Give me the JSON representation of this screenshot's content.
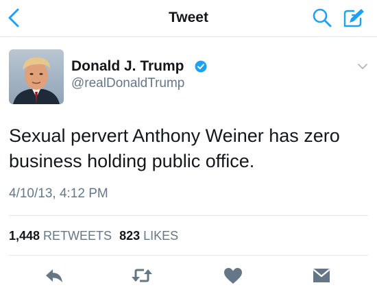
{
  "header": {
    "title": "Tweet",
    "back_icon": "chevron-left-icon",
    "search_icon": "search-icon",
    "compose_icon": "compose-icon"
  },
  "author": {
    "name": "Donald J. Trump",
    "handle": "@realDonaldTrump",
    "verified": true,
    "avatar_icon": "avatar-photo"
  },
  "tweet": {
    "text": "Sexual pervert Anthony Weiner has zero business holding public office.",
    "timestamp": "4/10/13, 4:12 PM"
  },
  "stats": {
    "retweets_count": "1,448",
    "retweets_label": "RETWEETS",
    "likes_count": "823",
    "likes_label": "LIKES"
  },
  "actions": [
    "reply-icon",
    "retweet-icon",
    "like-icon",
    "direct-message-icon"
  ],
  "colors": {
    "accent": "#1da1f2",
    "text": "#14171a",
    "secondary_text": "#657786",
    "divider": "#e1e8ed",
    "action_icon": "#657786"
  }
}
